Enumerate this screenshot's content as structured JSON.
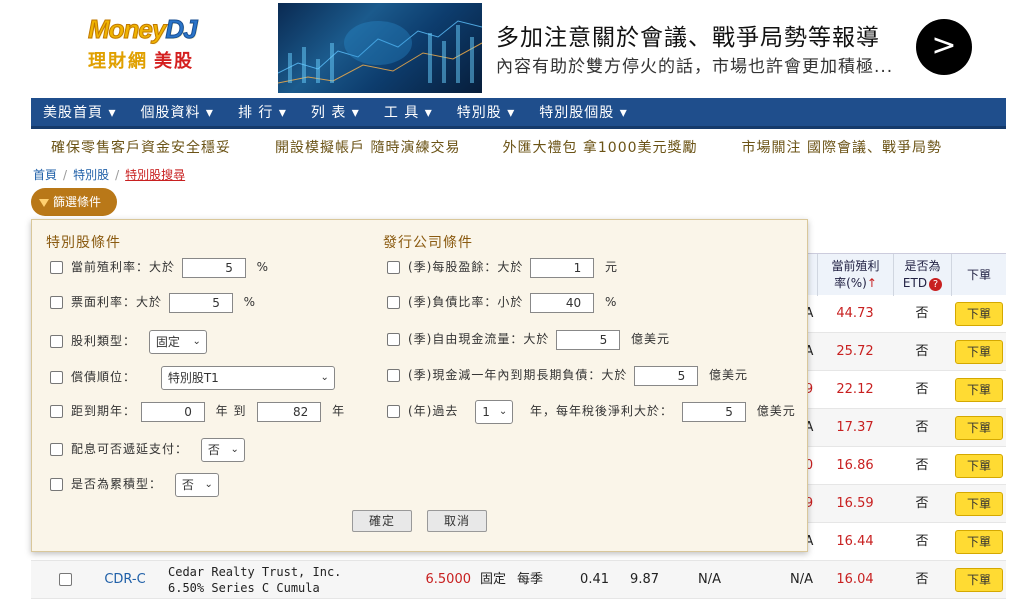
{
  "logo": {
    "brand_part1": "MoneyDJ",
    "brand_main": "Money",
    "brand_dj": "DJ",
    "sub": "理財網",
    "sub_us": "美股"
  },
  "banner": {
    "title": "多加注意關於會議、戰爭局勢等報導",
    "subtitle": "內容有助於雙方停火的話，市場也許會更加積極...",
    "arrow": ">"
  },
  "nav": [
    {
      "label": "美股首頁 ▾"
    },
    {
      "label": "個股資料 ▾"
    },
    {
      "label": "排 行 ▾"
    },
    {
      "label": "列 表 ▾"
    },
    {
      "label": "工 具 ▾"
    },
    {
      "label": "特別股 ▾"
    },
    {
      "label": "特別股個股 ▾"
    }
  ],
  "subnav": [
    "確保零售客戶資金安全穩妥",
    "開設模擬帳戶 隨時演練交易",
    "外匯大禮包 拿1000美元獎勵",
    "市場關注 國際會議、戰爭局勢"
  ],
  "breadcrumb": {
    "home": "首頁",
    "mid": "特別股",
    "current": "特別股搜尋",
    "sep": "/"
  },
  "filter_button": "篩選條件",
  "panel": {
    "left_title": "特別股條件",
    "right_title": "發行公司條件",
    "left_rows": [
      {
        "label": "當前殖利率：大於",
        "value": "5",
        "unit": "%"
      },
      {
        "label": "票面利率：大於",
        "value": "5",
        "unit": "%"
      },
      {
        "label": "股利類型：",
        "select": "固定"
      },
      {
        "label": "償債順位：",
        "select": "特別股T1"
      },
      {
        "label": "距到期年：",
        "from": "0",
        "mid": "年 到",
        "to": "82",
        "unit": "年"
      },
      {
        "label": "配息可否遞延支付：",
        "select": "否"
      },
      {
        "label": "是否為累積型：",
        "select": "否"
      }
    ],
    "right_rows": [
      {
        "label": "(季)每股盈餘：大於",
        "value": "1",
        "unit": "元"
      },
      {
        "label": "(季)負債比率：小於",
        "value": "40",
        "unit": "%"
      },
      {
        "label": "(季)自由現金流量：大於",
        "value": "5",
        "unit": "億美元"
      },
      {
        "label": "(季)現金減一年內到期長期負債：大於",
        "value": "5",
        "unit": "億美元"
      },
      {
        "label": "(年)過去",
        "select": "1",
        "mid": "年，每年稅後淨利大於：",
        "value": "5",
        "unit": "億美元"
      }
    ],
    "confirm": "確定",
    "cancel": "取消"
  },
  "table": {
    "headers": {
      "yield": "當前殖利率(%)↑",
      "yield_l1": "當前殖利",
      "yield_l2": "率(%)",
      "etd_l1": "是否為",
      "etd_l2": "ETD",
      "order": "下單",
      "help": "?"
    },
    "rows": [
      {
        "frag": "A",
        "yield": "44.73",
        "etd": "否",
        "order": "下單"
      },
      {
        "frag": "A",
        "yield": "25.72",
        "etd": "否",
        "order": "下單"
      },
      {
        "frag": "9",
        "yield": "22.12",
        "etd": "否",
        "order": "下單"
      },
      {
        "frag": "A",
        "yield": "17.37",
        "etd": "否",
        "order": "下單"
      },
      {
        "frag": "0",
        "yield": "16.86",
        "etd": "否",
        "order": "下單"
      },
      {
        "frag": "9",
        "yield": "16.59",
        "etd": "否",
        "order": "下單"
      },
      {
        "frag": "A",
        "yield": "16.44",
        "etd": "否",
        "order": "下單"
      }
    ],
    "last_row": {
      "symbol": "CDR-C",
      "name_l1": "Cedar Realty Trust, Inc.",
      "name_l2": "6.50% Series C Cumula",
      "price": "6.5000",
      "type": "固定",
      "freq": "每季",
      "v1": "0.41",
      "v2": "9.87",
      "v3": "N/A",
      "v4": "N/A",
      "yield": "16.04",
      "etd": "否",
      "order": "下單"
    }
  }
}
